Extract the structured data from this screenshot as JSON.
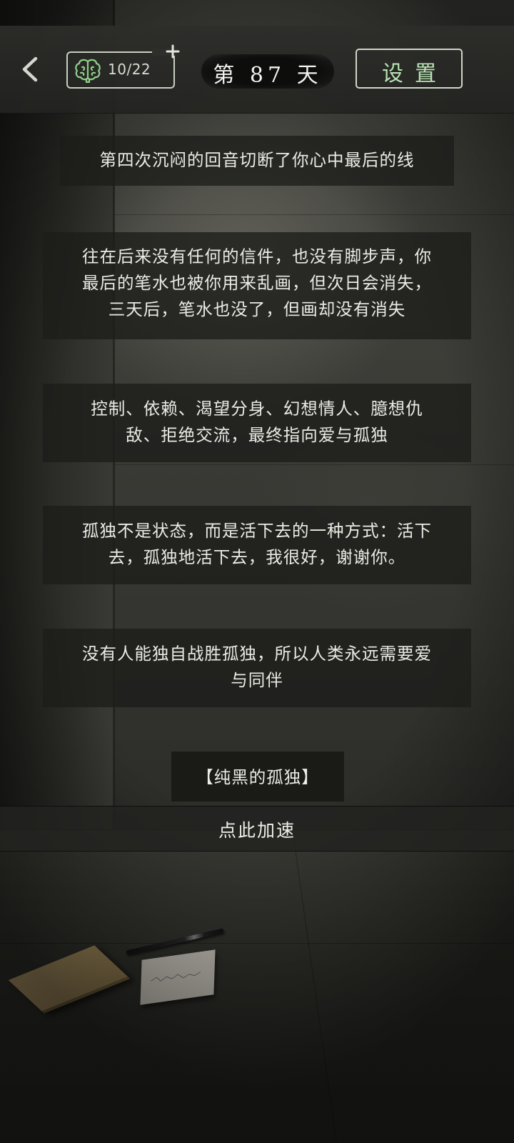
{
  "topbar": {
    "back_icon": "chevron-left-icon",
    "brain": {
      "icon": "brain-icon",
      "count": "10/22",
      "add_icon": "plus-icon"
    },
    "day_label": "第 87 天",
    "settings_label": "设置"
  },
  "story": {
    "block1": {
      "lines": [
        "第四次沉闷的回音切断了你心中最后的线"
      ]
    },
    "block2": {
      "lines": [
        "往在后来没有任何的信件，也没有脚步声，你",
        "最后的笔水也被你用来乱画，但次日会消失，",
        "三天后，笔水也没了，但画却没有消失"
      ]
    },
    "block3": {
      "lines": [
        "控制、依赖、渴望分身、幻想情人、臆想仇",
        "敌、拒绝交流，最终指向爱与孤独"
      ]
    },
    "block4": {
      "lines": [
        "孤独不是状态，而是活下去的一种方式：活下",
        "去，孤独地活下去，我很好，谢谢你。"
      ]
    },
    "block5": {
      "lines": [
        "没有人能独自战胜孤独，所以人类永远需要爱",
        "与同伴"
      ]
    }
  },
  "ending": {
    "title": "【纯黑的孤独】"
  },
  "speedup": {
    "label": "点此加速"
  },
  "colors": {
    "accent_green": "#b9e3b4",
    "panel_bg": "#1c1c1a",
    "text": "#ecece6"
  }
}
